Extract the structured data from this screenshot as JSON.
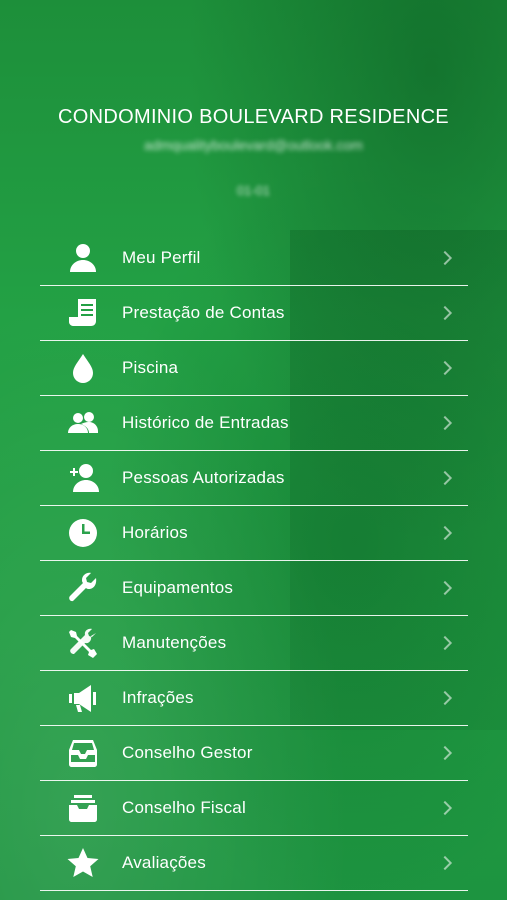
{
  "header": {
    "title": "CONDOMINIO BOULEVARD RESIDENCE",
    "email": "admqualityboulevard@outlook.com",
    "unit": "01-01"
  },
  "menu": {
    "items": [
      {
        "label": "Meu Perfil",
        "icon": "user-icon"
      },
      {
        "label": "Prestação de Contas",
        "icon": "receipt-icon"
      },
      {
        "label": "Piscina",
        "icon": "water-drop-icon"
      },
      {
        "label": "Histórico de Entradas",
        "icon": "group-icon"
      },
      {
        "label": "Pessoas Autorizadas",
        "icon": "add-user-icon"
      },
      {
        "label": "Horários",
        "icon": "clock-icon"
      },
      {
        "label": "Equipamentos",
        "icon": "wrench-icon"
      },
      {
        "label": "Manutenções",
        "icon": "tools-icon"
      },
      {
        "label": "Infrações",
        "icon": "megaphone-icon"
      },
      {
        "label": "Conselho Gestor",
        "icon": "inbox-icon"
      },
      {
        "label": "Conselho Fiscal",
        "icon": "archive-icon"
      },
      {
        "label": "Avaliações",
        "icon": "star-icon"
      }
    ]
  },
  "colors": {
    "background": "#1f9a3f",
    "text": "#ffffff"
  }
}
